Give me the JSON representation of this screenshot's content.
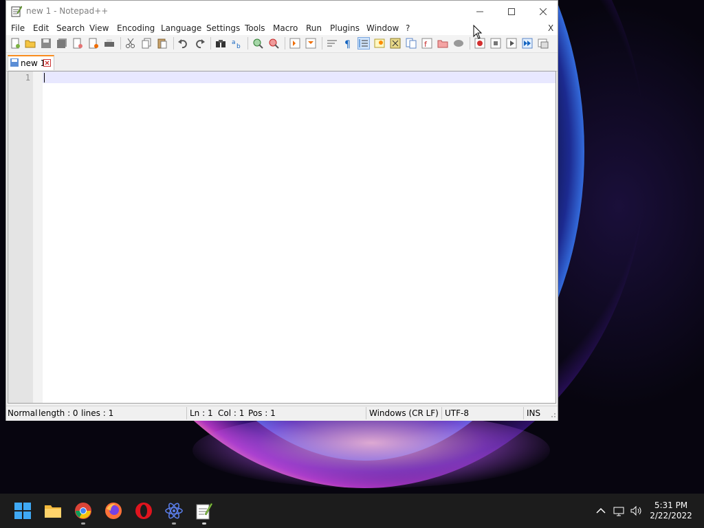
{
  "window": {
    "title": "new 1 - Notepad++",
    "controls": {
      "minimize": "—",
      "maximize": "☐",
      "close": "✕"
    }
  },
  "menu": {
    "items": [
      "File",
      "Edit",
      "Search",
      "View",
      "Encoding",
      "Language",
      "Settings",
      "Tools",
      "Macro",
      "Run",
      "Plugins",
      "Window",
      "?"
    ],
    "close_doc": "X"
  },
  "tabs": [
    {
      "label": "new 1"
    }
  ],
  "editor": {
    "line_numbers": [
      "1"
    ]
  },
  "status": {
    "mode": "Normal",
    "length": "length : 0",
    "lines": "lines : 1",
    "ln": "Ln : 1",
    "col": "Col : 1",
    "pos": "Pos : 1",
    "eol": "Windows (CR LF)",
    "encoding": "UTF-8",
    "insert": "INS"
  },
  "taskbar": {
    "apps": [
      "start-menu",
      "file-explorer",
      "chrome",
      "firefox",
      "opera",
      "atom",
      "notepadpp"
    ],
    "time": "5:31 PM",
    "date": "2/22/2022"
  },
  "colors": {
    "tab_accent": "#fa8c1e",
    "current_line": "#e8e8ff",
    "taskbar": "#1c1c1c"
  }
}
